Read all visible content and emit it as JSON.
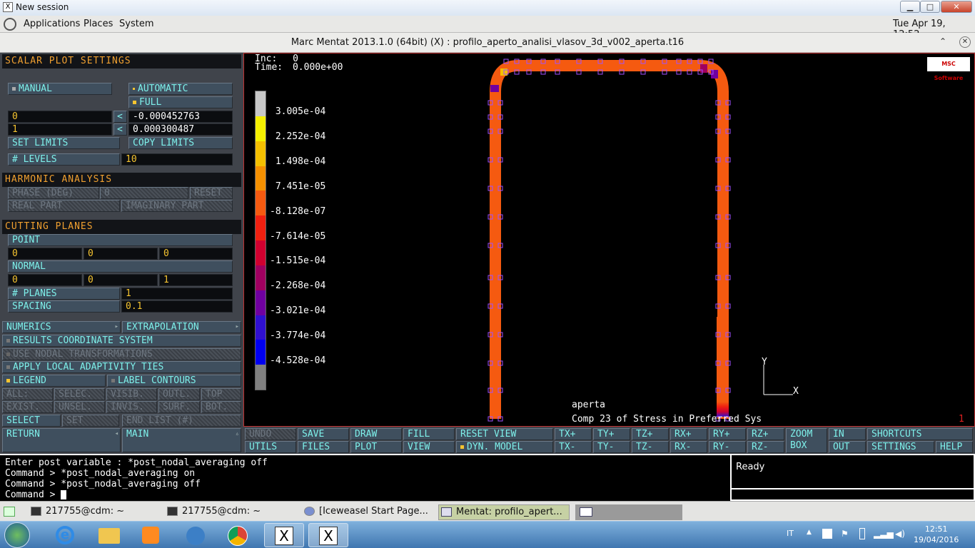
{
  "window": {
    "title": "New session",
    "min": "▁",
    "max": "□",
    "close": "✕"
  },
  "gnome": {
    "applications": "Applications",
    "places": "Places",
    "system": "System",
    "datetime": "Tue Apr 19, 12:52"
  },
  "app": {
    "title": "Marc Mentat 2013.1.0 (64bit) (X) : profilo_aperto_analisi_vlasov_3d_v002_aperta.t16"
  },
  "panel": {
    "scalar_header": "SCALAR PLOT SETTINGS",
    "manual": "MANUAL",
    "automatic": "AUTOMATIC",
    "full": "FULL",
    "min_label": "0",
    "min_value": "-0.000452763",
    "max_label": "1",
    "max_value": "0.000300487",
    "set_limits": "SET LIMITS",
    "copy_limits": "COPY LIMITS",
    "levels_label": "# LEVELS",
    "levels_value": "10",
    "harmonic_header": "HARMONIC ANALYSIS",
    "phase": "PHASE (DEG)",
    "phase_value": "0",
    "reset": "RESET",
    "real_part": "REAL PART",
    "imaginary_part": "IMAGINARY PART",
    "cutting_header": "CUTTING PLANES",
    "point": "POINT",
    "point_vals": [
      "0",
      "0",
      "0"
    ],
    "normal": "NORMAL",
    "normal_vals": [
      "0",
      "0",
      "1"
    ],
    "planes_label": "# PLANES",
    "planes_value": "1",
    "spacing_label": "SPACING",
    "spacing_value": "0.1",
    "numerics": "NUMERICS",
    "extrapolation": "EXTRAPOLATION",
    "results_coord": "RESULTS COORDINATE SYSTEM",
    "use_nodal": "USE NODAL TRANSFORMATIONS",
    "apply_local": "APPLY LOCAL ADAPTIVITY TIES",
    "legend": "LEGEND",
    "label_contours": "LABEL CONTOURS",
    "row1": [
      "ALL:",
      "SELEC.",
      "VISIB.",
      "OUTL.",
      "TOP"
    ],
    "row2": [
      "EXIST.",
      "UNSEL.",
      "INVIS.",
      "SURF.",
      "BOT."
    ],
    "select": "SELECT",
    "set": "SET",
    "end_list": "END LIST (#)",
    "return": "RETURN",
    "main": "MAIN"
  },
  "viewport": {
    "inc_label": "Inc:",
    "inc_value": "0",
    "time_label": "Time:",
    "time_value": "0.000e+00",
    "legend_values": [
      "3.005e-04",
      "2.252e-04",
      "1.498e-04",
      "7.451e-05",
      "-8.128e-07",
      "-7.614e-05",
      "-1.515e-04",
      "-2.268e-04",
      "-3.021e-04",
      "-3.774e-04",
      "-4.528e-04"
    ],
    "legend_colors": [
      "#c8c8c8",
      "#f5f000",
      "#f5c000",
      "#f59000",
      "#f55a10",
      "#f02010",
      "#d00030",
      "#a00060",
      "#7000a0",
      "#3010d0",
      "#0000f0",
      "#808080"
    ],
    "msc_logo": "MSC Software",
    "axis_y": "Y",
    "axis_x": "X",
    "model_name": "aperta",
    "subtitle": "Comp 23 of Stress in Preferred Sys",
    "window_num": "1"
  },
  "toolbar": {
    "undo": "UNDO",
    "save": "SAVE",
    "draw": "DRAW",
    "fill": "FILL",
    "reset_view": "RESET VIEW",
    "tx_plus": "TX+",
    "ty_plus": "TY+",
    "tz_plus": "TZ+",
    "rx_plus": "RX+",
    "ry_plus": "RY+",
    "rz_plus": "RZ+",
    "zoom_box_1": "ZOOM",
    "zoom_box_2": "BOX",
    "in": "IN",
    "shortcuts": "SHORTCUTS",
    "utils": "UTILS",
    "files": "FILES",
    "plot": "PLOT",
    "view": "VIEW",
    "dyn_model": "DYN. MODEL",
    "tx_minus": "TX-",
    "ty_minus": "TY-",
    "tz_minus": "TZ-",
    "rx_minus": "RX-",
    "ry_minus": "RY-",
    "rz_minus": "RZ-",
    "out": "OUT",
    "settings": "SETTINGS",
    "help": "HELP"
  },
  "console": {
    "lines": [
      "Enter post variable : *post_nodal_averaging off",
      "Command > *post_nodal_averaging on",
      "Command > *post_nodal_averaging off",
      "Command > "
    ],
    "status": "Ready"
  },
  "tasks": [
    "217755@cdm: ~",
    "217755@cdm: ~",
    "[Iceweasel Start Page...",
    "Mentat: profilo_apert..."
  ],
  "tray": {
    "lang": "IT",
    "time": "12:51",
    "date": "19/04/2016"
  }
}
